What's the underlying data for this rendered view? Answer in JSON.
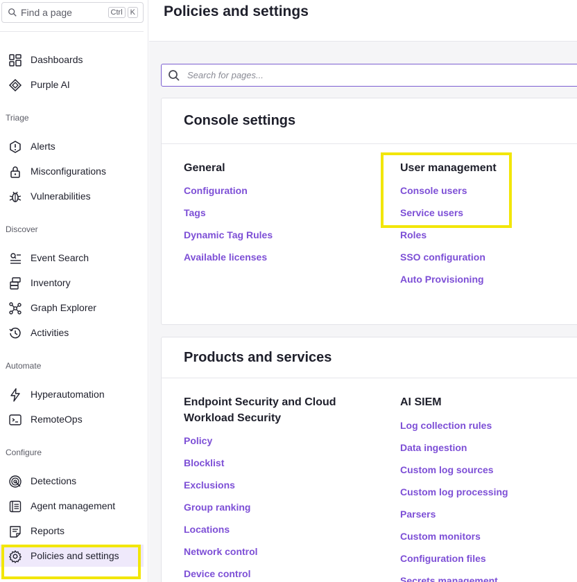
{
  "sidebar": {
    "search": {
      "placeholder": "Find a page",
      "shortcut_keys": [
        "Ctrl",
        "K"
      ]
    },
    "items_top": [
      {
        "label": "Dashboards",
        "icon": "dashboard-grid-icon"
      },
      {
        "label": "Purple AI",
        "icon": "purple-ai-icon"
      }
    ],
    "sections": [
      {
        "title": "Triage",
        "items": [
          {
            "label": "Alerts",
            "icon": "alert-hexagon-icon"
          },
          {
            "label": "Misconfigurations",
            "icon": "lock-icon"
          },
          {
            "label": "Vulnerabilities",
            "icon": "bug-icon"
          }
        ]
      },
      {
        "title": "Discover",
        "items": [
          {
            "label": "Event Search",
            "icon": "event-search-icon"
          },
          {
            "label": "Inventory",
            "icon": "inventory-stack-icon"
          },
          {
            "label": "Graph Explorer",
            "icon": "graph-nodes-icon"
          },
          {
            "label": "Activities",
            "icon": "history-clock-icon"
          }
        ]
      },
      {
        "title": "Automate",
        "items": [
          {
            "label": "Hyperautomation",
            "icon": "lightning-icon"
          },
          {
            "label": "RemoteOps",
            "icon": "terminal-window-icon"
          }
        ]
      },
      {
        "title": "Configure",
        "items": [
          {
            "label": "Detections",
            "icon": "radar-icon"
          },
          {
            "label": "Agent management",
            "icon": "agent-list-icon"
          },
          {
            "label": "Reports",
            "icon": "report-doc-icon"
          },
          {
            "label": "Policies and settings",
            "icon": "gear-icon",
            "active": true
          }
        ]
      }
    ]
  },
  "page": {
    "title": "Policies and settings",
    "search_placeholder": "Search for pages..."
  },
  "console_settings": {
    "title": "Console settings",
    "columns": [
      {
        "heading": "General",
        "links": [
          "Configuration",
          "Tags",
          "Dynamic Tag Rules",
          "Available licenses"
        ]
      },
      {
        "heading": "User management",
        "links": [
          "Console users",
          "Service users",
          "Roles",
          "SSO configuration",
          "Auto Provisioning"
        ]
      }
    ]
  },
  "products_services": {
    "title": "Products and services",
    "columns": [
      {
        "heading": "Endpoint Security and Cloud Workload Security",
        "links": [
          "Policy",
          "Blocklist",
          "Exclusions",
          "Group ranking",
          "Locations",
          "Network control",
          "Device control"
        ]
      },
      {
        "heading": "AI SIEM",
        "links": [
          "Log collection rules",
          "Data ingestion",
          "Custom log sources",
          "Custom log processing",
          "Parsers",
          "Custom monitors",
          "Configuration files",
          "Secrets management"
        ]
      }
    ]
  },
  "colors": {
    "accent": "#7d4fd6",
    "highlight": "#f2e609",
    "active_bg": "#efe9fb"
  }
}
